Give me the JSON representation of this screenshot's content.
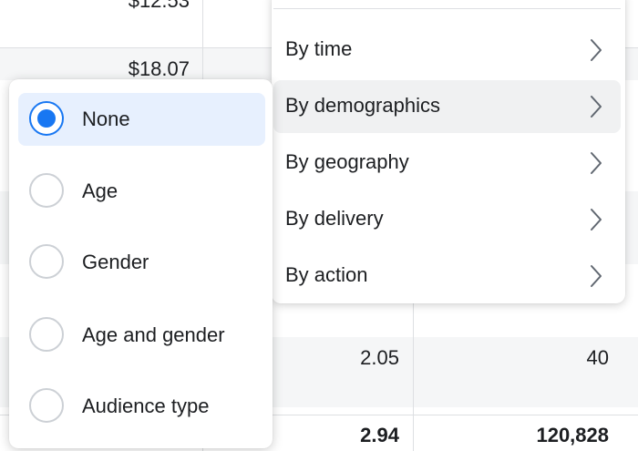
{
  "table": {
    "cells": {
      "top_partial": "$12.53",
      "cost_2": "$18.07",
      "row_a_col1": "2.05",
      "row_a_col2": "40",
      "total_col1": "2.94",
      "total_col2": "120,828"
    }
  },
  "breakdown_menu": {
    "items": [
      {
        "label": "By time",
        "icon": "chevron-right-icon"
      },
      {
        "label": "By demographics",
        "icon": "chevron-right-icon",
        "active": true
      },
      {
        "label": "By geography",
        "icon": "chevron-right-icon"
      },
      {
        "label": "By delivery",
        "icon": "chevron-right-icon"
      },
      {
        "label": "By action",
        "icon": "chevron-right-icon"
      }
    ]
  },
  "demographics_submenu": {
    "options": [
      {
        "label": "None",
        "selected": true
      },
      {
        "label": "Age",
        "selected": false
      },
      {
        "label": "Gender",
        "selected": false
      },
      {
        "label": "Age and gender",
        "selected": false
      },
      {
        "label": "Audience type",
        "selected": false
      }
    ]
  },
  "colors": {
    "accent": "#1877f2",
    "selected_bg": "#e7f0fe",
    "active_bg": "#f0f1f2",
    "row_shade": "#f5f6f7",
    "divider": "#dddfe2"
  }
}
